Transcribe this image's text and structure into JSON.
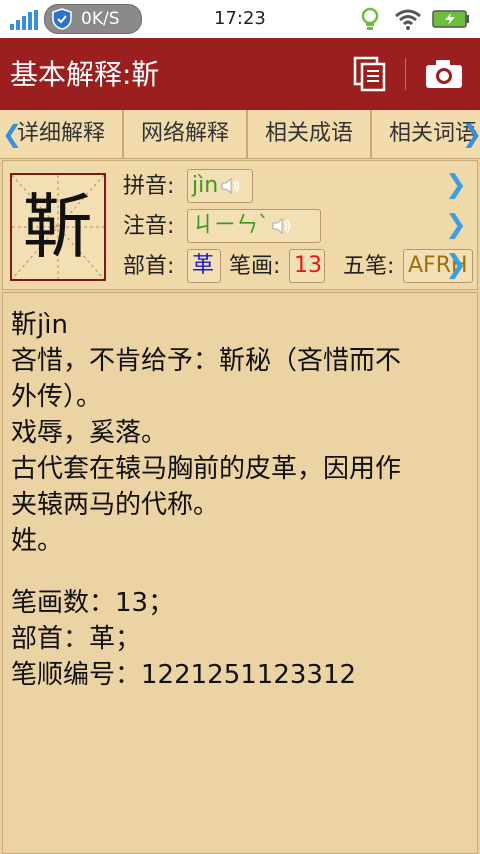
{
  "status_bar": {
    "net_speed": "0K/S",
    "time": "17:23",
    "colors": {
      "signal": "#3a8fd8",
      "bulb": "#6bbf3b",
      "battery": "#6bbf3b"
    }
  },
  "title_bar": {
    "title": "基本解释:靳",
    "bg_color": "#9c1f1f"
  },
  "tabs": [
    {
      "label": "详细解释"
    },
    {
      "label": "网络解释"
    },
    {
      "label": "相关成语"
    },
    {
      "label": "相关词语"
    }
  ],
  "tab_arrows": {
    "left": "❮",
    "right": "❯"
  },
  "info": {
    "character": "靳",
    "pinyin_label": "拼音:",
    "pinyin": "jìn",
    "zhuyin_label": "注音:",
    "zhuyin": "ㄐㄧㄣˋ",
    "radical_label": "部首:",
    "radical": "革",
    "strokes_label": "笔画:",
    "strokes": "13",
    "wubi_label": "五笔:",
    "wubi": "AFRH",
    "chevron": "❯",
    "colors": {
      "pinyin": "#3c9a1a",
      "radical": "#1a1ad0",
      "strokes": "#e01a1a",
      "wubi": "#a07010"
    }
  },
  "content": {
    "lines": [
      "靳jìn",
      "吝惜，不肯给予：靳秘（吝惜而不",
      "外传）。",
      "戏辱，奚落。",
      "古代套在辕马胸前的皮革，因用作",
      "夹辕两马的代称。",
      "姓。",
      "",
      "笔画数：13；",
      "部首：革；",
      "笔顺编号：1221251123312"
    ]
  }
}
